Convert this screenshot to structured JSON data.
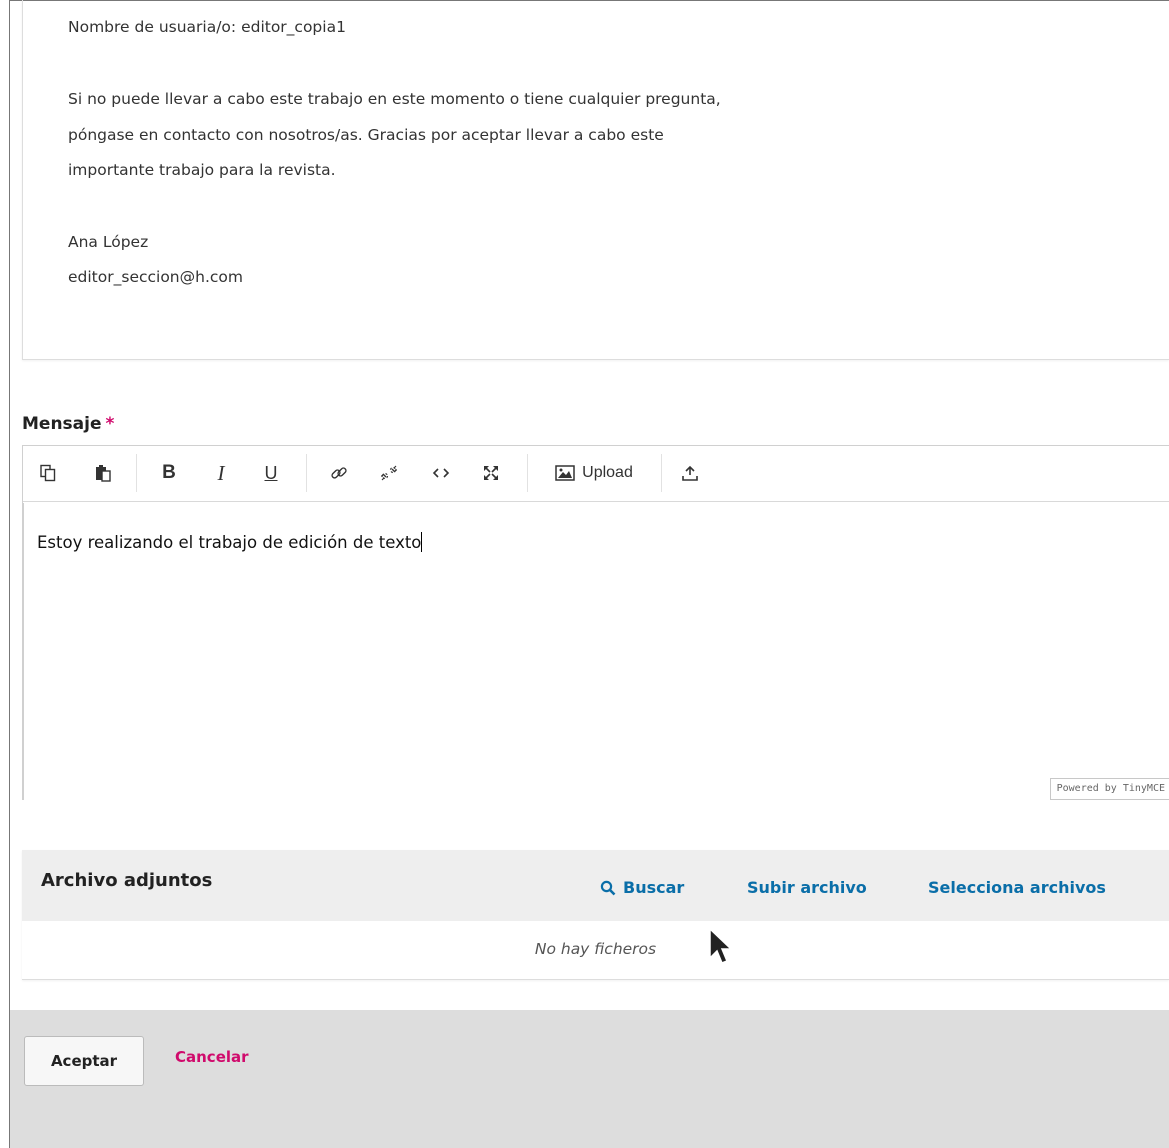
{
  "preview": {
    "username_line": "Nombre de usuaria/o: editor_copia1",
    "paragraph_lines": [
      "Si no puede llevar a cabo este trabajo en este momento o tiene cualquier pregunta,",
      "póngase en contacto con nosotros/as. Gracias por aceptar llevar a cabo este",
      "importante trabajo para la revista."
    ],
    "signature_name": "Ana López",
    "signature_email": "editor_seccion@h.com"
  },
  "message": {
    "label": "Mensaje",
    "required_mark": "*",
    "body_text": "Estoy realizando el trabajo de edición de texto",
    "toolbar": {
      "copy_icon": "copy-icon",
      "paste_icon": "paste-icon",
      "bold_label": "B",
      "italic_label": "I",
      "underline_label": "U",
      "link_icon": "link-icon",
      "unlink_icon": "unlink-icon",
      "code_icon": "code-icon",
      "fullscreen_icon": "fullscreen-icon",
      "upload_label": "Upload",
      "insert_file_icon": "upload-tray-icon"
    },
    "powered_by": "Powered by TinyMCE"
  },
  "attachments": {
    "title": "Archivo adjuntos",
    "search_label": "Buscar",
    "upload_label": "Subir archivo",
    "select_label": "Selecciona archivos",
    "empty_text": "No hay ficheros"
  },
  "footer": {
    "accept_label": "Aceptar",
    "cancel_label": "Cancelar"
  },
  "colors": {
    "accent_link": "#0a6ea8",
    "danger_pink": "#d00a6c",
    "panel_header": "#eeeeee",
    "footer_bg": "#dddddd"
  }
}
